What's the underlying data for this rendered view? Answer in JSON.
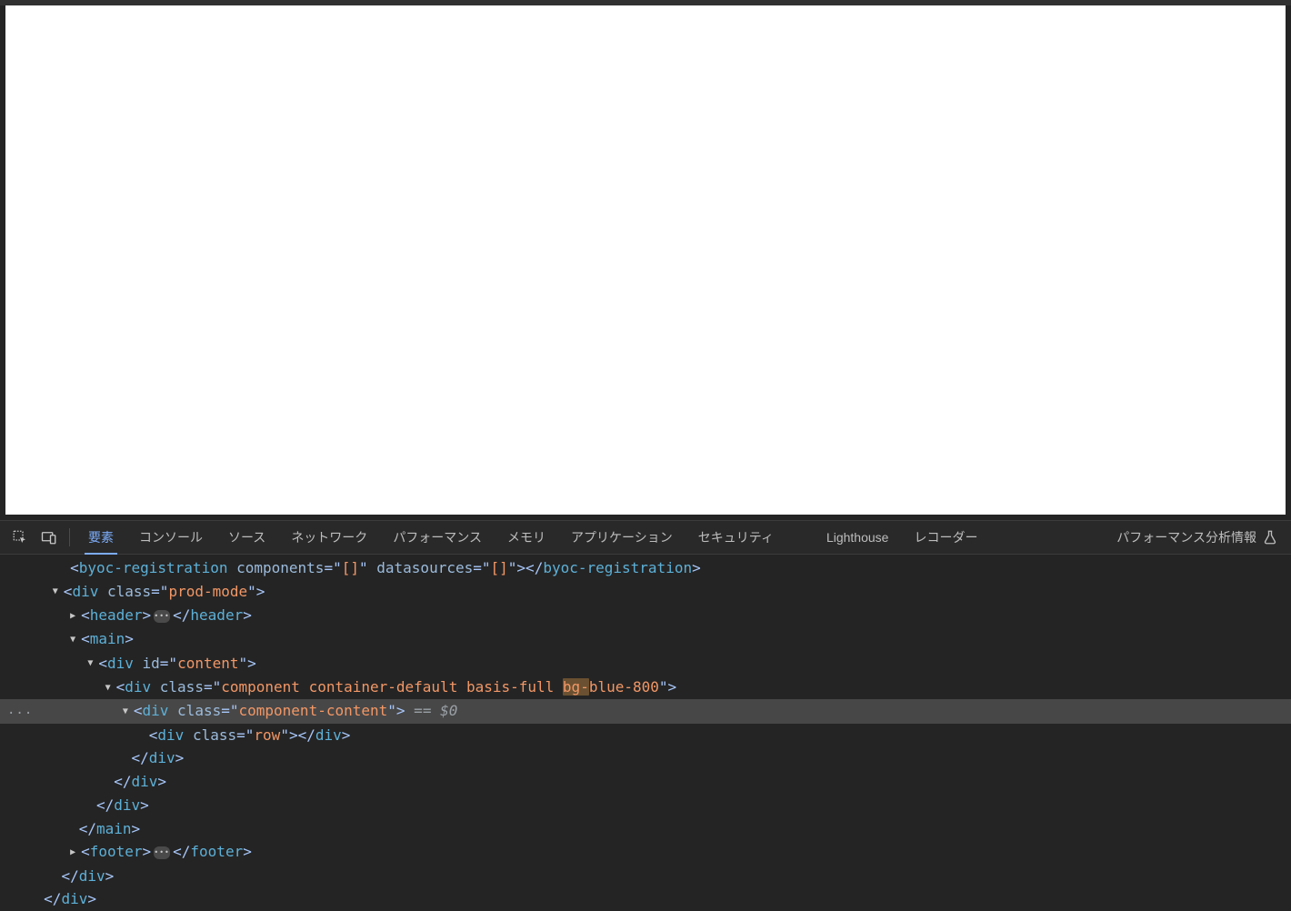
{
  "tabs": {
    "elements": "要素",
    "console": "コンソール",
    "sources": "ソース",
    "network": "ネットワーク",
    "performance": "パフォーマンス",
    "memory": "メモリ",
    "application": "アプリケーション",
    "security": "セキュリティ",
    "lighthouse": "Lighthouse",
    "recorder": "レコーダー",
    "perf_insights": "パフォーマンス分析情報"
  },
  "dom": {
    "line0": {
      "components_attr": "components",
      "components_val": "[]",
      "datasources_attr": "datasources",
      "datasources_val": "[]",
      "tag": "byoc-registration"
    },
    "line1": {
      "tag": "div",
      "attr": "class",
      "val": "prod-mode"
    },
    "line2": {
      "tag": "header"
    },
    "line3": {
      "tag": "main"
    },
    "line4": {
      "tag": "div",
      "attr": "id",
      "val": "content"
    },
    "line5": {
      "tag": "div",
      "attr": "class",
      "val_pre": "component container-default basis-full ",
      "val_hl": "bg-",
      "val_post": "blue-800"
    },
    "line6": {
      "tag": "div",
      "attr": "class",
      "val": "component-content",
      "eq0": " == $0"
    },
    "line7": {
      "tag": "div",
      "attr": "class",
      "val": "row"
    },
    "line8": {
      "close": "div"
    },
    "line9": {
      "close": "div"
    },
    "line10": {
      "close": "div"
    },
    "line11": {
      "close": "main"
    },
    "line12": {
      "tag": "footer"
    },
    "line13": {
      "close": "div"
    },
    "line14": {
      "close": "div"
    }
  },
  "ellipsis": "..."
}
